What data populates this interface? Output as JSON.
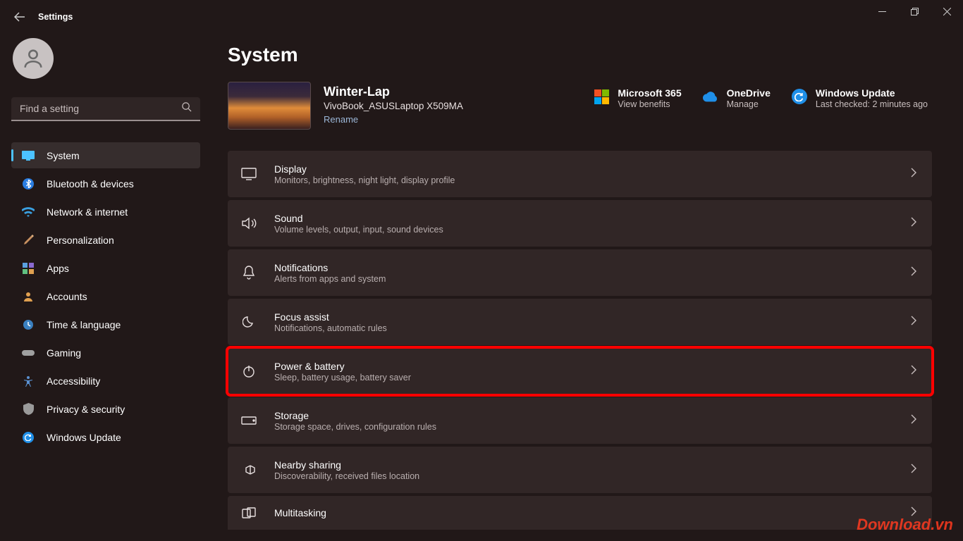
{
  "window": {
    "title": "Settings"
  },
  "search": {
    "placeholder": "Find a setting"
  },
  "nav": {
    "items": [
      {
        "label": "System"
      },
      {
        "label": "Bluetooth & devices"
      },
      {
        "label": "Network & internet"
      },
      {
        "label": "Personalization"
      },
      {
        "label": "Apps"
      },
      {
        "label": "Accounts"
      },
      {
        "label": "Time & language"
      },
      {
        "label": "Gaming"
      },
      {
        "label": "Accessibility"
      },
      {
        "label": "Privacy & security"
      },
      {
        "label": "Windows Update"
      }
    ]
  },
  "page": {
    "title": "System"
  },
  "device": {
    "name": "Winter-Lap",
    "model": "VivoBook_ASUSLaptop X509MA",
    "rename": "Rename"
  },
  "status": {
    "ms365": {
      "title": "Microsoft 365",
      "sub": "View benefits"
    },
    "onedrive": {
      "title": "OneDrive",
      "sub": "Manage"
    },
    "update": {
      "title": "Windows Update",
      "sub": "Last checked: 2 minutes ago"
    }
  },
  "cards": [
    {
      "title": "Display",
      "sub": "Monitors, brightness, night light, display profile"
    },
    {
      "title": "Sound",
      "sub": "Volume levels, output, input, sound devices"
    },
    {
      "title": "Notifications",
      "sub": "Alerts from apps and system"
    },
    {
      "title": "Focus assist",
      "sub": "Notifications, automatic rules"
    },
    {
      "title": "Power & battery",
      "sub": "Sleep, battery usage, battery saver"
    },
    {
      "title": "Storage",
      "sub": "Storage space, drives, configuration rules"
    },
    {
      "title": "Nearby sharing",
      "sub": "Discoverability, received files location"
    },
    {
      "title": "Multitasking",
      "sub": ""
    }
  ],
  "watermark": "Download.vn"
}
